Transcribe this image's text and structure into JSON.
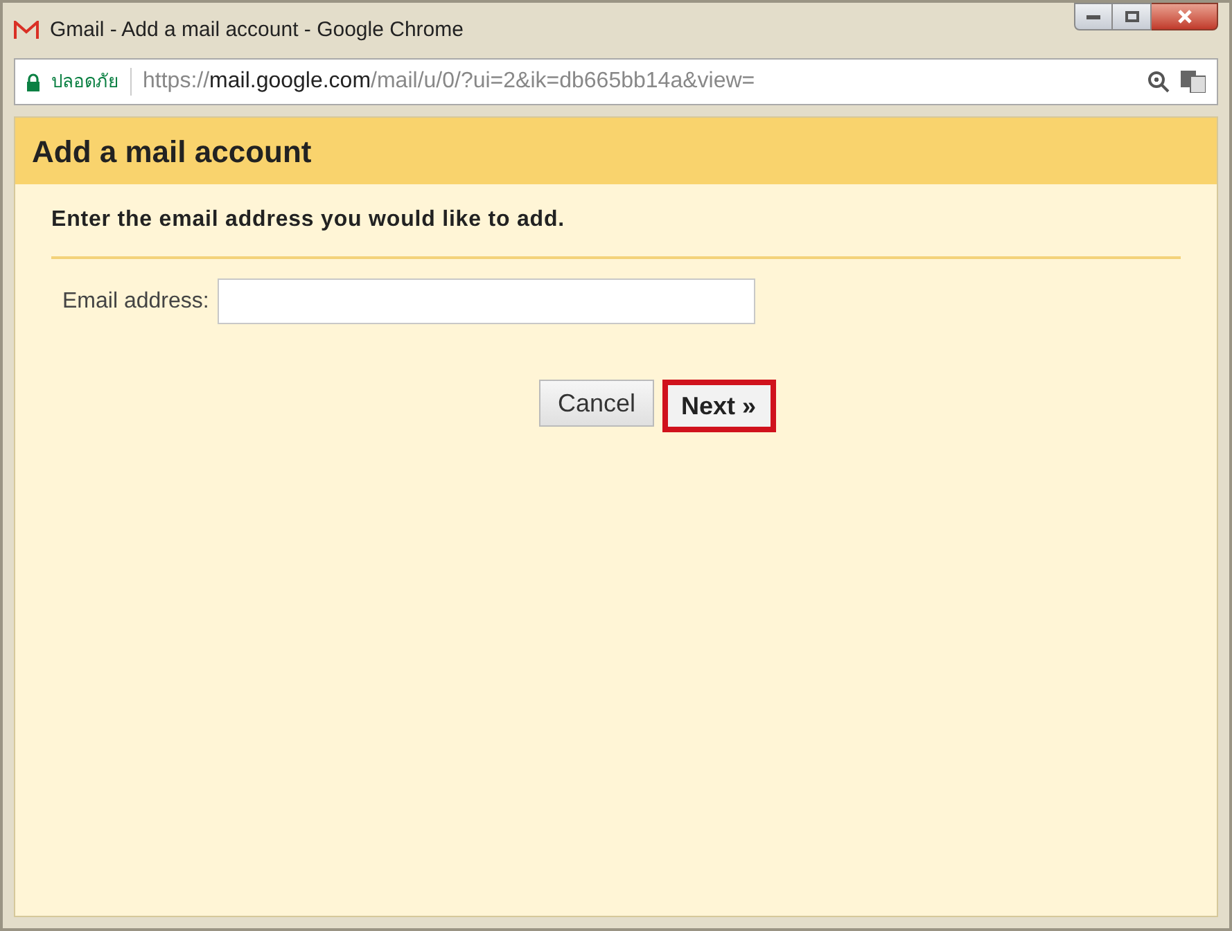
{
  "window": {
    "title": "Gmail - Add a mail account - Google Chrome"
  },
  "address_bar": {
    "security_label": "ปลอดภัย",
    "url_scheme": "https://",
    "url_host": "mail.google.com",
    "url_path": "/mail/u/0/?ui=2&ik=db665bb14a&view="
  },
  "dialog": {
    "title": "Add a mail account",
    "instruction": "Enter the email address you would like to add.",
    "field": {
      "label": "Email address:"
    },
    "buttons": [
      {
        "label": "Cancel",
        "highlighted": false
      },
      {
        "label": "Next »",
        "highlighted": true
      }
    ]
  }
}
